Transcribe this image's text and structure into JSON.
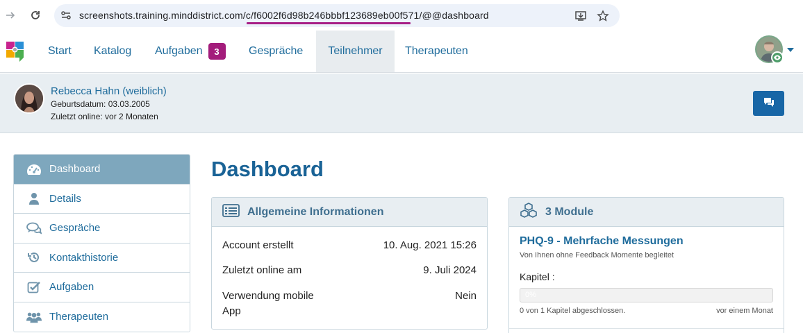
{
  "browser": {
    "url_prefix": "screenshots.training.minddistrict.com/c/",
    "url_highlight": "f6002f6d98b246bbbf123689eb00f571",
    "url_suffix": "/@@dashboard"
  },
  "nav": {
    "items": [
      {
        "label": "Start"
      },
      {
        "label": "Katalog"
      },
      {
        "label": "Aufgaben",
        "badge": "3"
      },
      {
        "label": "Gespräche"
      },
      {
        "label": "Teilnehmer",
        "active": true
      },
      {
        "label": "Therapeuten"
      }
    ]
  },
  "patient": {
    "name": "Rebecca Hahn (weiblich)",
    "birthdate": "Geburtsdatum: 03.03.2005",
    "last_online": "Zuletzt online: vor 2 Monaten"
  },
  "sidebar": {
    "items": [
      {
        "label": "Dashboard",
        "icon": "dashboard-icon",
        "active": true
      },
      {
        "label": "Details",
        "icon": "user-icon"
      },
      {
        "label": "Gespräche",
        "icon": "chat-icon"
      },
      {
        "label": "Kontakthistorie",
        "icon": "history-icon"
      },
      {
        "label": "Aufgaben",
        "icon": "check-square-icon"
      },
      {
        "label": "Therapeuten",
        "icon": "group-icon"
      }
    ]
  },
  "main": {
    "title": "Dashboard",
    "info_card": {
      "title": "Allgemeine Informationen",
      "rows": [
        {
          "key": "Account erstellt",
          "value": "10. Aug. 2021 15:26"
        },
        {
          "key": "Zuletzt online am",
          "value": "9. Juli 2024"
        },
        {
          "key": "Verwendung mobile App",
          "value": "Nein"
        }
      ]
    },
    "module_card": {
      "title": "3 Module",
      "module_name": "PHQ-9 - Mehrfache Messungen",
      "module_sub": "Von Ihnen ohne Feedback Momente begleitet",
      "kapitel_label": "Kapitel :",
      "progress_text": "0%",
      "progress_percent": 0,
      "chapters_done": "0 von 1 Kapitel abgeschlossen.",
      "time": "vor einem Monat"
    }
  },
  "colors": {
    "primary": "#1f6c9c",
    "badge": "#a31c7b",
    "sidebar_active": "#7ea7bd",
    "url_highlight": "#a71e86"
  }
}
